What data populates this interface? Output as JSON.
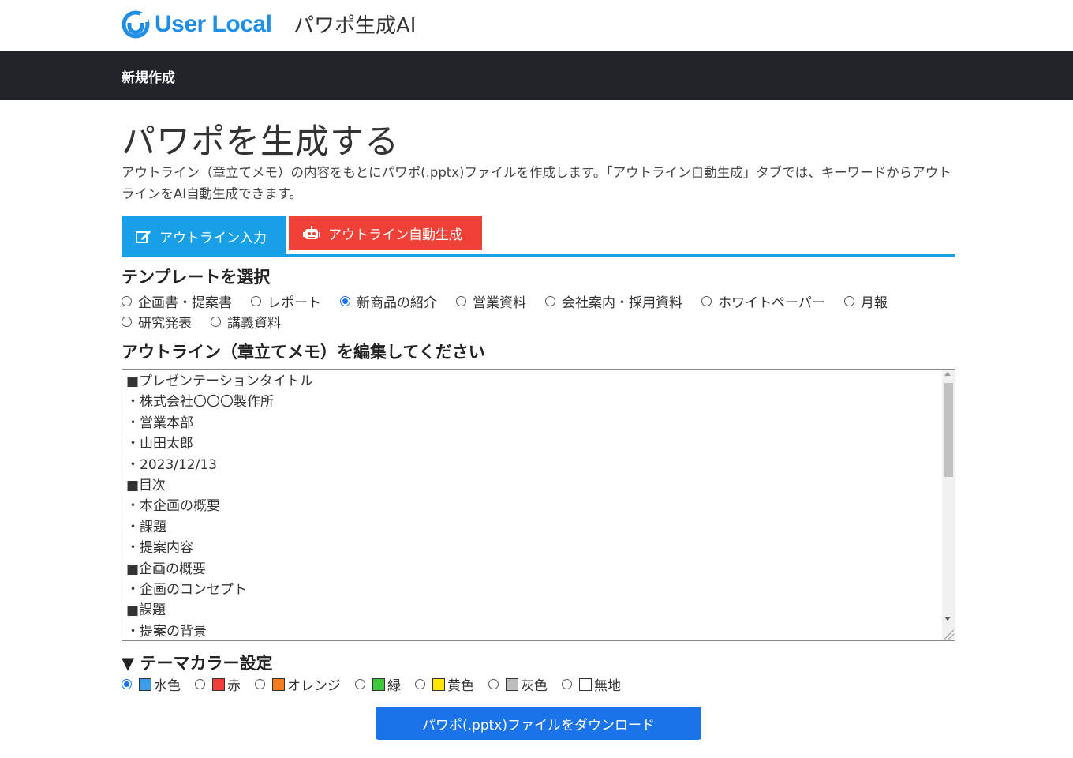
{
  "header": {
    "logo_text": "User Local",
    "product_name": "パワポ生成AI",
    "brand_color": "#1f8ee6"
  },
  "navbar": {
    "item": "新規作成"
  },
  "main": {
    "title": "パワポを生成する",
    "description": "アウトライン（章立てメモ）の内容をもとにパワポ(.pptx)ファイルを作成します。「アウトライン自動生成」タブでは、キーワードからアウトラインをAI自動生成できます。",
    "tabs": [
      {
        "label": "アウトライン入力",
        "icon": "edit-icon",
        "active": true,
        "color": "#18a0e6"
      },
      {
        "label": "アウトライン自動生成",
        "icon": "robot-icon",
        "active": false,
        "color": "#ef4137"
      }
    ]
  },
  "template": {
    "title": "テンプレートを選択",
    "options": [
      "企画書・提案書",
      "レポート",
      "新商品の紹介",
      "営業資料",
      "会社案内・採用資料",
      "ホワイトペーパー",
      "月報",
      "研究発表",
      "講義資料"
    ],
    "selected": "新商品の紹介"
  },
  "outline": {
    "title": "アウトライン（章立てメモ）を編集してください",
    "lines": [
      "■プレゼンテーションタイトル",
      "・株式会社〇〇〇製作所",
      "・営業本部",
      "・山田太郎",
      "・2023/12/13",
      "■目次",
      "・本企画の概要",
      "・課題",
      "・提案内容",
      "■企画の概要",
      "・企画のコンセプト",
      "■課題",
      "・提案の背景"
    ]
  },
  "theme": {
    "title": "▼ テーマカラー設定",
    "options": [
      {
        "label": "水色",
        "color": "#3d9be9"
      },
      {
        "label": "赤",
        "color": "#ef4137"
      },
      {
        "label": "オレンジ",
        "color": "#f57c1f"
      },
      {
        "label": "緑",
        "color": "#3ec93e"
      },
      {
        "label": "黄色",
        "color": "#ffe600"
      },
      {
        "label": "灰色",
        "color": "#bdbdbd"
      },
      {
        "label": "無地",
        "color": "#ffffff"
      }
    ],
    "selected": "水色"
  },
  "download": {
    "label": "パワポ(.pptx)ファイルをダウンロード"
  }
}
